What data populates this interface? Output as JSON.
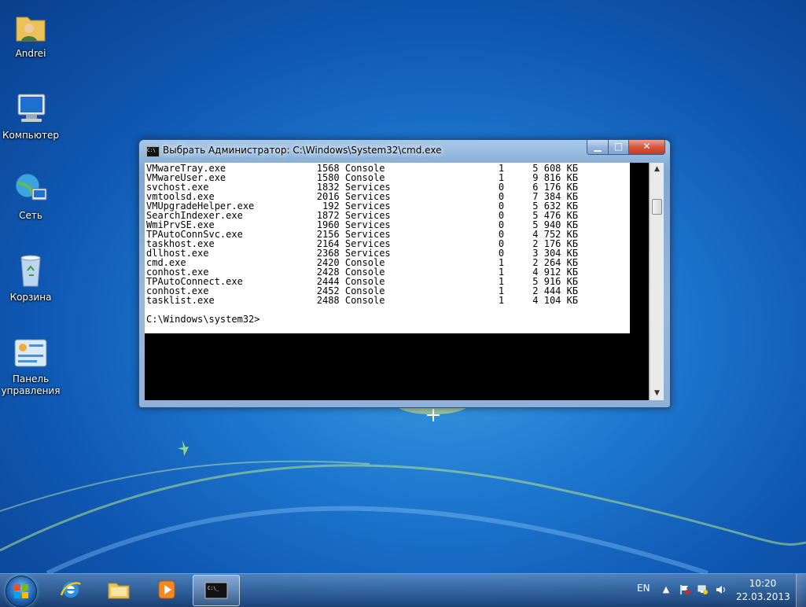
{
  "desktop": {
    "icons": [
      {
        "label": "Andrei",
        "icon": "user-folder-icon"
      },
      {
        "label": "Компьютер",
        "icon": "computer-icon"
      },
      {
        "label": "Сеть",
        "icon": "network-icon"
      },
      {
        "label": "Корзина",
        "icon": "recycle-bin-icon"
      },
      {
        "label": "Панель управления",
        "icon": "control-panel-icon"
      }
    ]
  },
  "window": {
    "title": "Выбрать Администратор: C:\\Windows\\System32\\cmd.exe",
    "buttons": {
      "minimize": "▁",
      "maximize": "□",
      "close": "✕"
    }
  },
  "console": {
    "rows": [
      {
        "name": "VMwareTray.exe",
        "pid": "1568",
        "session": "Console",
        "num": "1",
        "mem": "5 608 КБ"
      },
      {
        "name": "VMwareUser.exe",
        "pid": "1580",
        "session": "Console",
        "num": "1",
        "mem": "9 816 КБ"
      },
      {
        "name": "svchost.exe",
        "pid": "1832",
        "session": "Services",
        "num": "0",
        "mem": "6 176 КБ"
      },
      {
        "name": "vmtoolsd.exe",
        "pid": "2016",
        "session": "Services",
        "num": "0",
        "mem": "7 384 КБ"
      },
      {
        "name": "VMUpgradeHelper.exe",
        "pid": "192",
        "session": "Services",
        "num": "0",
        "mem": "5 632 КБ"
      },
      {
        "name": "SearchIndexer.exe",
        "pid": "1872",
        "session": "Services",
        "num": "0",
        "mem": "5 476 КБ"
      },
      {
        "name": "WmiPrvSE.exe",
        "pid": "1960",
        "session": "Services",
        "num": "0",
        "mem": "5 940 КБ"
      },
      {
        "name": "TPAutoConnSvc.exe",
        "pid": "2156",
        "session": "Services",
        "num": "0",
        "mem": "4 752 КБ"
      },
      {
        "name": "taskhost.exe",
        "pid": "2164",
        "session": "Services",
        "num": "0",
        "mem": "2 176 КБ"
      },
      {
        "name": "dllhost.exe",
        "pid": "2368",
        "session": "Services",
        "num": "0",
        "mem": "3 304 КБ"
      },
      {
        "name": "cmd.exe",
        "pid": "2420",
        "session": "Console",
        "num": "1",
        "mem": "2 264 КБ"
      },
      {
        "name": "conhost.exe",
        "pid": "2428",
        "session": "Console",
        "num": "1",
        "mem": "4 912 КБ"
      },
      {
        "name": "TPAutoConnect.exe",
        "pid": "2444",
        "session": "Console",
        "num": "1",
        "mem": "5 916 КБ"
      },
      {
        "name": "conhost.exe",
        "pid": "2452",
        "session": "Console",
        "num": "1",
        "mem": "2 444 КБ"
      },
      {
        "name": "tasklist.exe",
        "pid": "2488",
        "session": "Console",
        "num": "1",
        "mem": "4 104 КБ"
      }
    ],
    "prompt": "C:\\Windows\\system32>"
  },
  "taskbar": {
    "pinned": [
      {
        "icon": "internet-explorer-icon"
      },
      {
        "icon": "explorer-folder-icon"
      },
      {
        "icon": "media-player-icon"
      },
      {
        "icon": "cmd-icon",
        "active": true
      }
    ],
    "tray": {
      "language": "EN",
      "time": "10:20",
      "date": "22.03.2013"
    }
  },
  "colors": {
    "wallpaper": "#1e78cf",
    "console_bg": "#000000",
    "selection_bg": "#ffffff",
    "close_button": "#c43a1e"
  }
}
